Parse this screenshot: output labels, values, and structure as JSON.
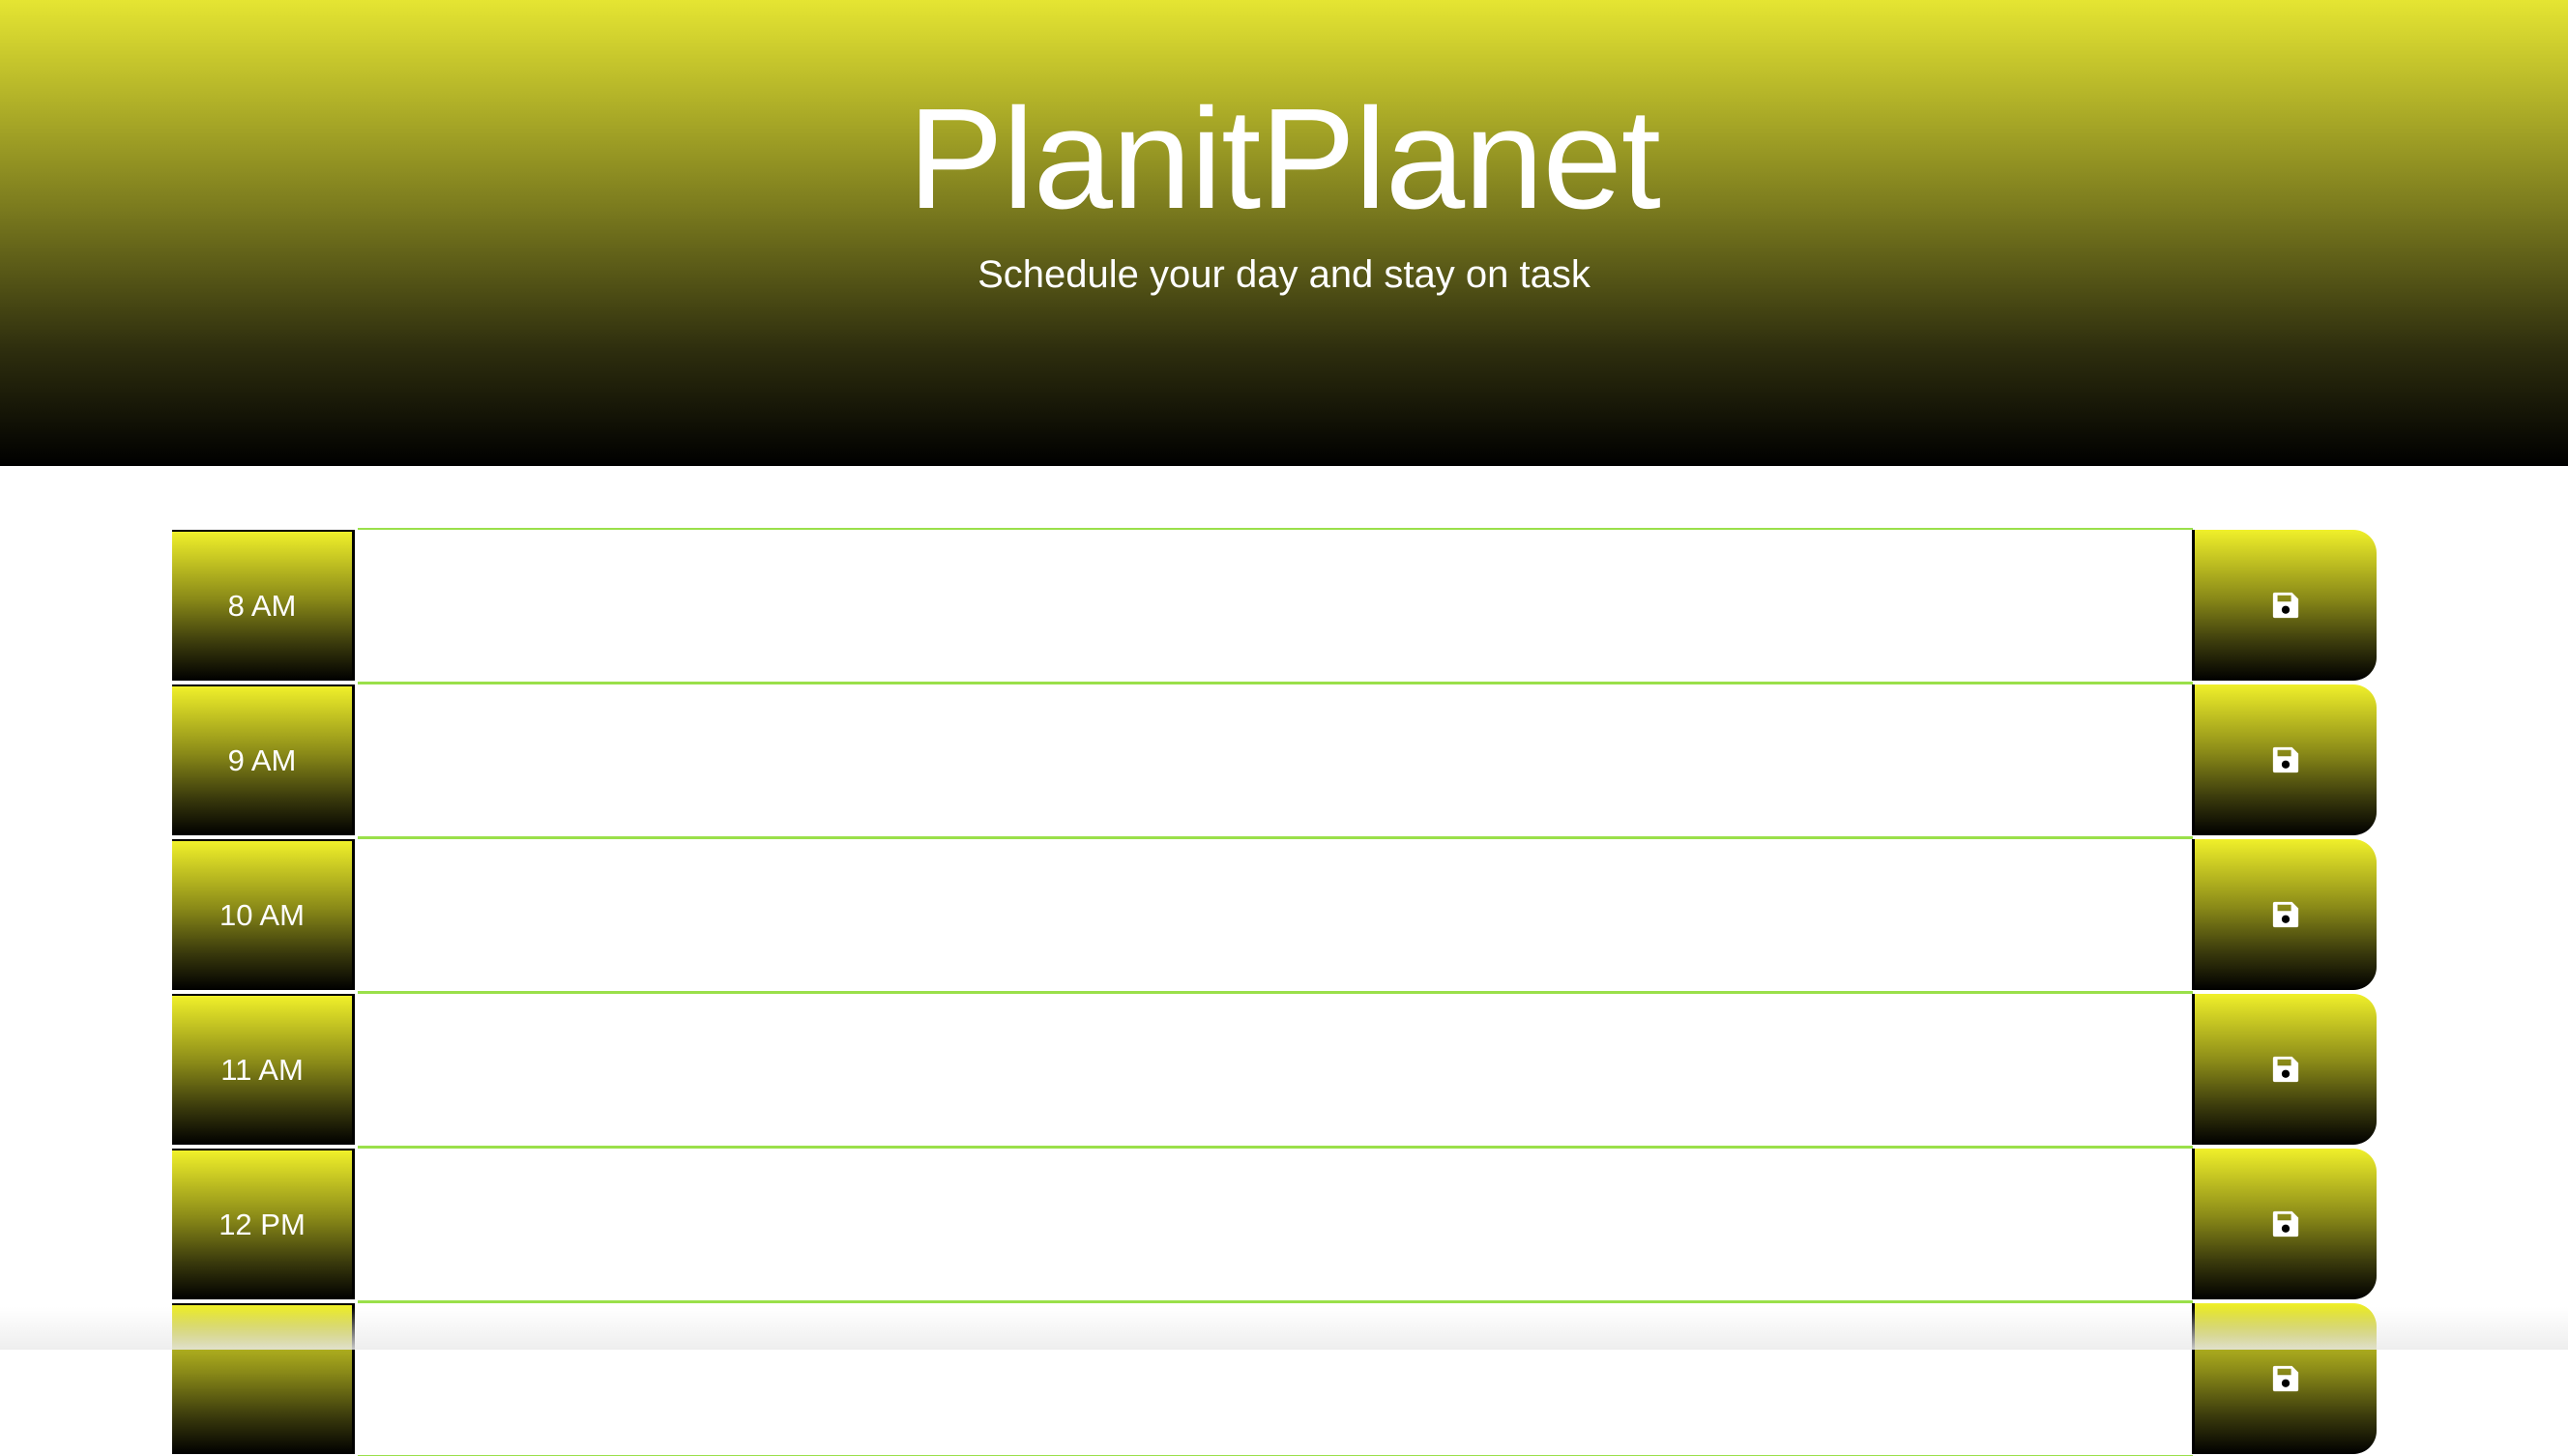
{
  "header": {
    "title": "PlanitPlanet",
    "subtitle": "Schedule your day and stay on task"
  },
  "schedule": {
    "rows": [
      {
        "hour": "8 AM",
        "description": "",
        "save_icon": "floppy-disk-icon"
      },
      {
        "hour": "9 AM",
        "description": "",
        "save_icon": "floppy-disk-icon"
      },
      {
        "hour": "10 AM",
        "description": "",
        "save_icon": "floppy-disk-icon"
      },
      {
        "hour": "11 AM",
        "description": "",
        "save_icon": "floppy-disk-icon"
      },
      {
        "hour": "12 PM",
        "description": "",
        "save_icon": "floppy-disk-icon"
      },
      {
        "hour": "",
        "description": "",
        "save_icon": "floppy-disk-icon"
      }
    ]
  },
  "colors": {
    "accent_yellow": "#e5e532",
    "row_border_green": "#9ae04a",
    "gradient_bottom": "#000000"
  }
}
